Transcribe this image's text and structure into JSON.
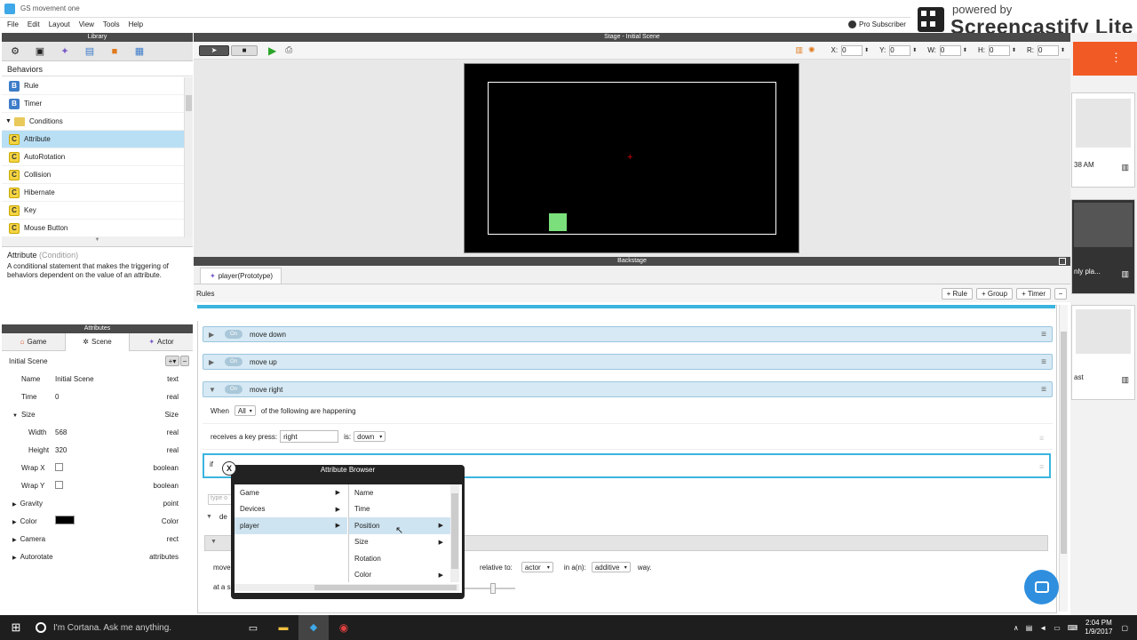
{
  "window": {
    "title": "GS movement one"
  },
  "menu": [
    "File",
    "Edit",
    "Layout",
    "View",
    "Tools",
    "Help"
  ],
  "pro_subscriber": "Pro Subscriber",
  "watermark": {
    "line1": "powered by",
    "line2": "Screencastify Lite"
  },
  "library": {
    "header": "Library",
    "section": "Behaviors",
    "items": [
      {
        "badge": "B",
        "label": "Rule"
      },
      {
        "badge": "B",
        "label": "Timer"
      },
      {
        "badge": "",
        "label": "Conditions"
      },
      {
        "badge": "C",
        "label": "Attribute"
      },
      {
        "badge": "C",
        "label": "AutoRotation"
      },
      {
        "badge": "C",
        "label": "Collision"
      },
      {
        "badge": "C",
        "label": "Hibernate"
      },
      {
        "badge": "C",
        "label": "Key"
      },
      {
        "badge": "C",
        "label": "Mouse Button"
      }
    ],
    "desc_title": "Attribute",
    "desc_kind": "(Condition)",
    "desc_text": "A conditional statement that makes the triggering of behaviors dependent on the value of an attribute."
  },
  "attributes": {
    "header": "Attributes",
    "tabs": [
      "Game",
      "Scene",
      "Actor"
    ],
    "scene_name": "Initial Scene",
    "rows": [
      {
        "name": "Name",
        "value": "Initial Scene",
        "type": "text"
      },
      {
        "name": "Time",
        "value": "0",
        "type": "real"
      },
      {
        "name": "Size",
        "value": "",
        "type": "Size"
      },
      {
        "name": "Width",
        "value": "568",
        "type": "real"
      },
      {
        "name": "Height",
        "value": "320",
        "type": "real"
      },
      {
        "name": "Wrap X",
        "value": "",
        "type": "boolean"
      },
      {
        "name": "Wrap Y",
        "value": "",
        "type": "boolean"
      },
      {
        "name": "Gravity",
        "value": "",
        "type": "point"
      },
      {
        "name": "Color",
        "value": "",
        "type": "Color"
      },
      {
        "name": "Camera",
        "value": "",
        "type": "rect"
      },
      {
        "name": "Autorotate",
        "value": "",
        "type": "attributes"
      }
    ]
  },
  "stage": {
    "header": "Stage - Initial Scene",
    "coords": [
      {
        "label": "X:",
        "value": "0"
      },
      {
        "label": "Y:",
        "value": "0"
      },
      {
        "label": "W:",
        "value": "0"
      },
      {
        "label": "H:",
        "value": "0"
      },
      {
        "label": "R:",
        "value": "0"
      }
    ]
  },
  "backstage": {
    "header": "Backstage",
    "proto_tab": "player(Prototype)",
    "rules_label": "Rules",
    "buttons": [
      "+ Rule",
      "+ Group",
      "+ Timer"
    ],
    "rules": [
      {
        "on": "On",
        "name": "move down"
      },
      {
        "on": "On",
        "name": "move up"
      },
      {
        "on": "On",
        "name": "move right"
      }
    ],
    "when_label": "When",
    "when_value": "All",
    "when_suffix": "of the following are happening",
    "key_label": "receives a key press:",
    "key_value": "right",
    "is_label": "is:",
    "is_value": "down",
    "if_label": "if",
    "type_placeholder": "type o",
    "de_label": "de",
    "move_label": "move",
    "relative_label": "relative to:",
    "relative_value": "actor",
    "ina_label": "in a(n):",
    "ina_value": "additive",
    "way_label": "way.",
    "atas_label": "at a s"
  },
  "attr_browser": {
    "title": "Attribute Browser",
    "col1": [
      "Game",
      "Devices",
      "player"
    ],
    "col2": [
      "Name",
      "Time",
      "Position",
      "Size",
      "Rotation",
      "Color"
    ]
  },
  "side_thumbs": [
    {
      "text": "38 AM"
    },
    {
      "text": "nly pla..."
    },
    {
      "text": "ast"
    }
  ],
  "taskbar": {
    "search": "I'm Cortana. Ask me anything.",
    "time": "2:04 PM",
    "date": "1/9/2017"
  },
  "colors": {
    "accent_orange": "#f15a24",
    "rule_blue": "#d6e9f4",
    "highlight": "#b9dff5",
    "actor_green": "#7be07b"
  }
}
